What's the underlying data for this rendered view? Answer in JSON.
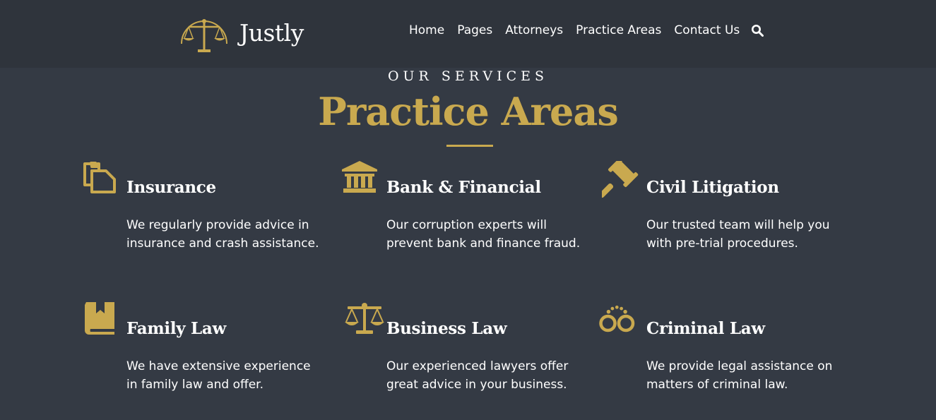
{
  "brand": {
    "name": "Justly"
  },
  "nav": {
    "items": [
      "Home",
      "Pages",
      "Attorneys",
      "Practice Areas",
      "Contact Us"
    ],
    "search_icon": "search-icon"
  },
  "section": {
    "eyebrow": "OUR SERVICES",
    "title": "Practice Areas"
  },
  "services": [
    {
      "icon": "documents-icon",
      "title": "Insurance",
      "text": "We regularly provide advice in insurance and crash assistance."
    },
    {
      "icon": "bank-icon",
      "title": "Bank & Financial",
      "text": "Our corruption experts will prevent bank and finance fraud."
    },
    {
      "icon": "gavel-icon",
      "title": "Civil Litigation",
      "text": "Our trusted team will help you with pre-trial procedures."
    },
    {
      "icon": "book-icon",
      "title": "Family Law",
      "text": "We have extensive experience in family law and offer."
    },
    {
      "icon": "scales-icon",
      "title": "Business Law",
      "text": "Our experienced lawyers offer great advice in your business."
    },
    {
      "icon": "handcuffs-icon",
      "title": "Criminal Law",
      "text": "We provide legal assistance on matters of criminal law."
    }
  ],
  "colors": {
    "accent": "#c9a94f",
    "background": "#343a44",
    "header": "#2f343c"
  }
}
